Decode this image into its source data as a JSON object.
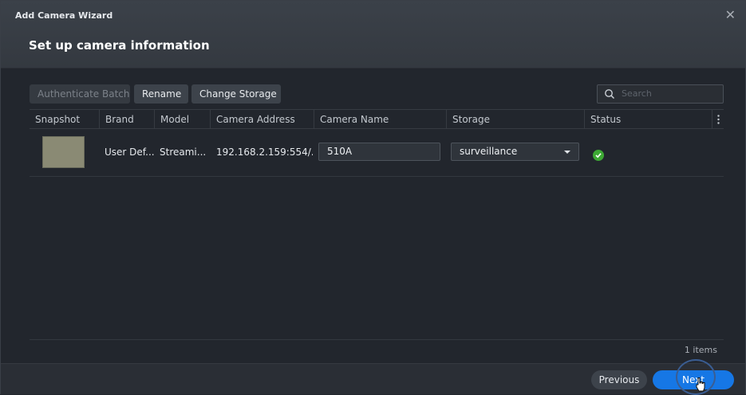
{
  "window": {
    "title": "Add Camera Wizard",
    "close_icon": "close-icon"
  },
  "page": {
    "heading": "Set up camera information"
  },
  "toolbar": {
    "authenticate_label": "Authenticate Batch",
    "rename_label": "Rename",
    "change_storage_label": "Change Storage"
  },
  "search": {
    "placeholder": "Search"
  },
  "table": {
    "columns": [
      "Snapshot",
      "Brand",
      "Model",
      "Camera Address",
      "Camera Name",
      "Storage",
      "Status"
    ],
    "rows": [
      {
        "snapshot": "",
        "brand": "User Def...",
        "model": "Streami...",
        "address": "192.168.2.159:554/...",
        "camera_name": "510A",
        "storage": "surveillance",
        "status": "ok"
      }
    ],
    "item_count": "1 items"
  },
  "footer": {
    "previous_label": "Previous",
    "next_label": "Next"
  },
  "colors": {
    "accent": "#1677e5",
    "status_ok": "#3da834"
  }
}
